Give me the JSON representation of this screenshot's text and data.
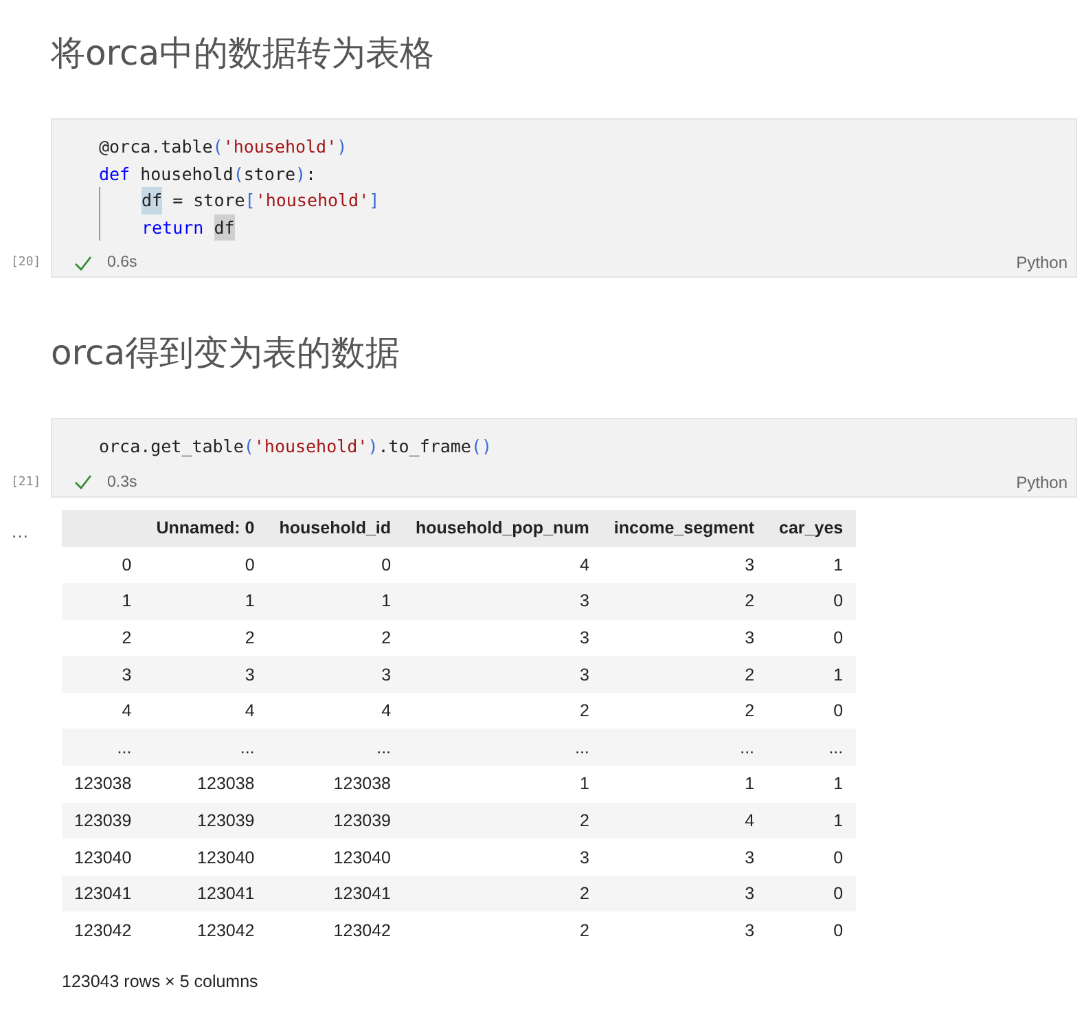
{
  "cells": [
    {
      "kind": "markdown",
      "heading": "将orca中的数据转为表格"
    },
    {
      "kind": "code",
      "exec_count": "[20]",
      "succeeded": true,
      "duration": "0.6s",
      "language": "Python",
      "lines": [
        {
          "indented": false,
          "tokens": [
            {
              "text": "@orca.table",
              "kind": "plain"
            },
            {
              "text": "(",
              "kind": "paren"
            },
            {
              "text": "'household'",
              "kind": "string"
            },
            {
              "text": ")",
              "kind": "paren"
            }
          ]
        },
        {
          "indented": false,
          "tokens": [
            {
              "text": "def",
              "kind": "keyword"
            },
            {
              "text": " household",
              "kind": "plain"
            },
            {
              "text": "(",
              "kind": "paren"
            },
            {
              "text": "store",
              "kind": "plain"
            },
            {
              "text": ")",
              "kind": "paren"
            },
            {
              "text": ":",
              "kind": "plain"
            }
          ]
        },
        {
          "indented": true,
          "tokens": [
            {
              "text": "df",
              "kind": "selected"
            },
            {
              "text": " = store",
              "kind": "plain"
            },
            {
              "text": "[",
              "kind": "paren"
            },
            {
              "text": "'household'",
              "kind": "string"
            },
            {
              "text": "]",
              "kind": "paren"
            }
          ]
        },
        {
          "indented": true,
          "tokens": [
            {
              "text": "return ",
              "kind": "keyword"
            },
            {
              "text": "df",
              "kind": "reference"
            }
          ]
        }
      ]
    },
    {
      "kind": "markdown",
      "heading": "orca得到变为表的数据"
    },
    {
      "kind": "code",
      "exec_count": "[21]",
      "succeeded": true,
      "duration": "0.3s",
      "language": "Python",
      "lines": [
        {
          "indented": false,
          "tokens": [
            {
              "text": "orca.get_table",
              "kind": "plain"
            },
            {
              "text": "(",
              "kind": "paren"
            },
            {
              "text": "'household'",
              "kind": "string"
            },
            {
              "text": ")",
              "kind": "paren"
            },
            {
              "text": ".to_frame",
              "kind": "plain"
            },
            {
              "text": "()",
              "kind": "paren"
            }
          ]
        }
      ]
    },
    {
      "kind": "output",
      "more_marker": "…",
      "table": {
        "columns": [
          "",
          "Unnamed: 0",
          "household_id",
          "household_pop_num",
          "income_segment",
          "car_yes"
        ],
        "rows": [
          [
            "0",
            "0",
            "0",
            "4",
            "3",
            "1"
          ],
          [
            "1",
            "1",
            "1",
            "3",
            "2",
            "0"
          ],
          [
            "2",
            "2",
            "2",
            "3",
            "3",
            "0"
          ],
          [
            "3",
            "3",
            "3",
            "3",
            "2",
            "1"
          ],
          [
            "4",
            "4",
            "4",
            "2",
            "2",
            "0"
          ],
          [
            "...",
            "...",
            "...",
            "...",
            "...",
            "..."
          ],
          [
            "123038",
            "123038",
            "123038",
            "1",
            "1",
            "1"
          ],
          [
            "123039",
            "123039",
            "123039",
            "2",
            "4",
            "1"
          ],
          [
            "123040",
            "123040",
            "123040",
            "3",
            "3",
            "0"
          ],
          [
            "123041",
            "123041",
            "123041",
            "2",
            "3",
            "0"
          ],
          [
            "123042",
            "123042",
            "123042",
            "2",
            "3",
            "0"
          ]
        ]
      },
      "summary": "123043 rows × 5 columns"
    }
  ]
}
